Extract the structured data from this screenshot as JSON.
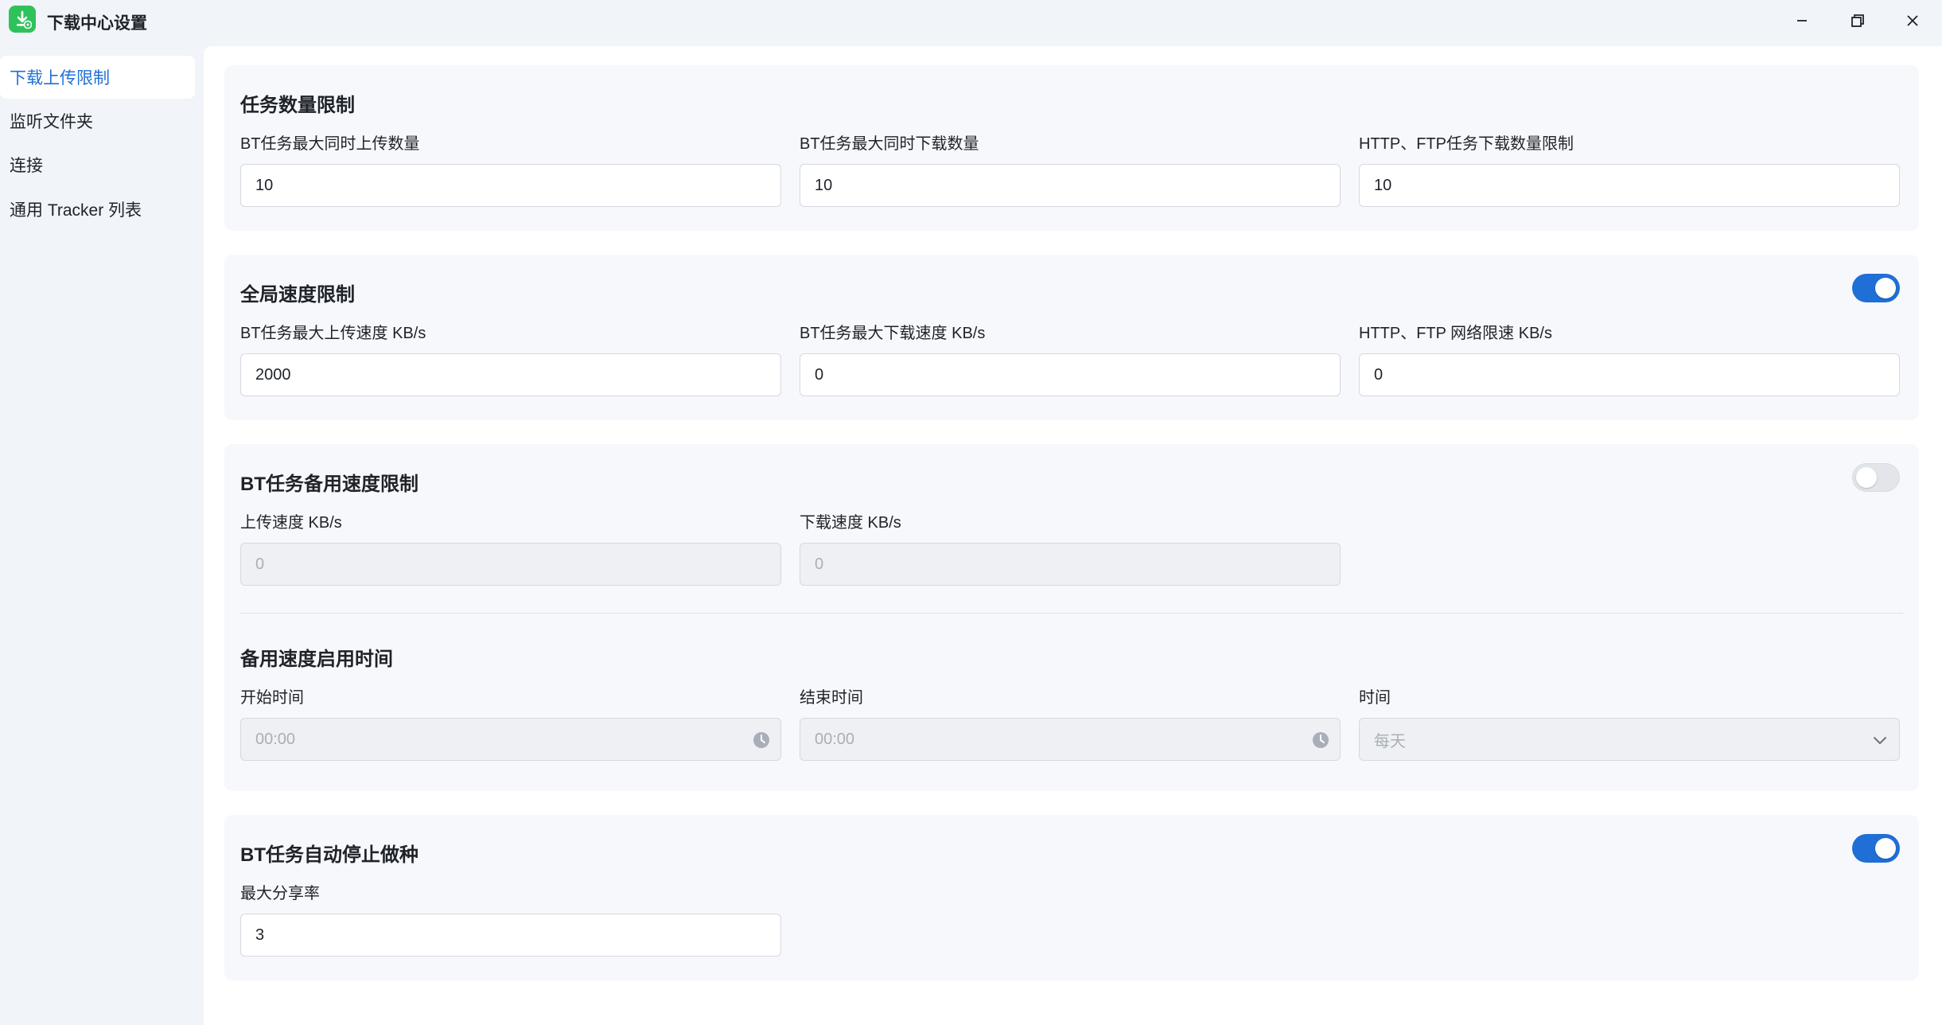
{
  "window": {
    "title": "下载中心设置",
    "accent": "#1f6fd6",
    "app_icon": "download-app-icon"
  },
  "sidebar": {
    "items": [
      {
        "label": "下载上传限制",
        "active": true
      },
      {
        "label": "监听文件夹",
        "active": false
      },
      {
        "label": "连接",
        "active": false
      },
      {
        "label": "通用 Tracker 列表",
        "active": false
      }
    ]
  },
  "task_limit": {
    "title": "任务数量限制",
    "fields": [
      {
        "label": "BT任务最大同时上传数量",
        "value": "10"
      },
      {
        "label": "BT任务最大同时下载数量",
        "value": "10"
      },
      {
        "label": "HTTP、FTP任务下载数量限制",
        "value": "10"
      }
    ]
  },
  "global_speed": {
    "title": "全局速度限制",
    "enabled": true,
    "fields": [
      {
        "label": "BT任务最大上传速度 KB/s",
        "value": "2000"
      },
      {
        "label": "BT任务最大下载速度 KB/s",
        "value": "0"
      },
      {
        "label": "HTTP、FTP 网络限速 KB/s",
        "value": "0"
      }
    ]
  },
  "bt_backup_speed": {
    "title": "BT任务备用速度限制",
    "enabled": false,
    "fields": [
      {
        "label": "上传速度 KB/s",
        "value": "0"
      },
      {
        "label": "下载速度 KB/s",
        "value": "0"
      }
    ],
    "schedule": {
      "title": "备用速度启用时间",
      "start_label": "开始时间",
      "start_value": "00:00",
      "end_label": "结束时间",
      "end_value": "00:00",
      "period_label": "时间",
      "period_value": "每天"
    }
  },
  "auto_stop_seeding": {
    "title": "BT任务自动停止做种",
    "enabled": true,
    "fields": [
      {
        "label": "最大分享率",
        "value": "3"
      }
    ]
  }
}
